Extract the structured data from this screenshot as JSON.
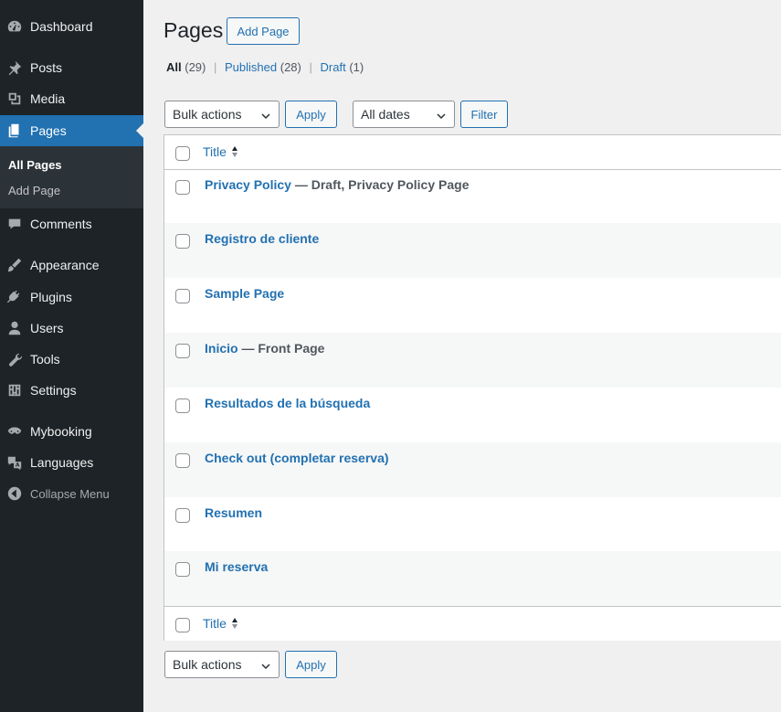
{
  "sidebar": {
    "items": [
      {
        "label": "Dashboard",
        "icon": "dashboard-icon"
      },
      {
        "label": "Posts",
        "icon": "pin-icon"
      },
      {
        "label": "Media",
        "icon": "media-icon"
      },
      {
        "label": "Pages",
        "icon": "pages-icon"
      },
      {
        "label": "Comments",
        "icon": "comment-icon"
      },
      {
        "label": "Appearance",
        "icon": "brush-icon"
      },
      {
        "label": "Plugins",
        "icon": "plug-icon"
      },
      {
        "label": "Users",
        "icon": "user-icon"
      },
      {
        "label": "Tools",
        "icon": "wrench-icon"
      },
      {
        "label": "Settings",
        "icon": "settings-icon"
      },
      {
        "label": "Mybooking",
        "icon": "mybooking-icon"
      },
      {
        "label": "Languages",
        "icon": "translate-icon"
      }
    ],
    "submenu": {
      "all_pages": "All Pages",
      "add_page": "Add Page"
    },
    "collapse_label": "Collapse Menu"
  },
  "header": {
    "title": "Pages",
    "add_button": "Add Page"
  },
  "filters_links": {
    "all": "All",
    "all_count": "(29)",
    "published": "Published",
    "published_count": "(28)",
    "draft": "Draft",
    "draft_count": "(1)",
    "separator": "|"
  },
  "toolbar": {
    "bulk_actions": "Bulk actions",
    "apply": "Apply",
    "dates": "All dates",
    "filter": "Filter"
  },
  "table": {
    "column_title": "Title",
    "rows": [
      {
        "title": "Privacy Policy",
        "state": " — Draft, Privacy Policy Page"
      },
      {
        "title": "Registro de cliente",
        "state": ""
      },
      {
        "title": "Sample Page",
        "state": ""
      },
      {
        "title": "Inicio",
        "state": " — Front Page"
      },
      {
        "title": "Resultados de la búsqueda",
        "state": ""
      },
      {
        "title": "Check out (completar reserva)",
        "state": ""
      },
      {
        "title": "Resumen",
        "state": ""
      },
      {
        "title": "Mi reserva",
        "state": ""
      }
    ]
  },
  "bottom_toolbar": {
    "bulk_actions": "Bulk actions",
    "apply": "Apply"
  },
  "colors": {
    "sidebar_bg": "#1d2327",
    "accent": "#2271b1",
    "page_bg": "#f0f0f1"
  }
}
